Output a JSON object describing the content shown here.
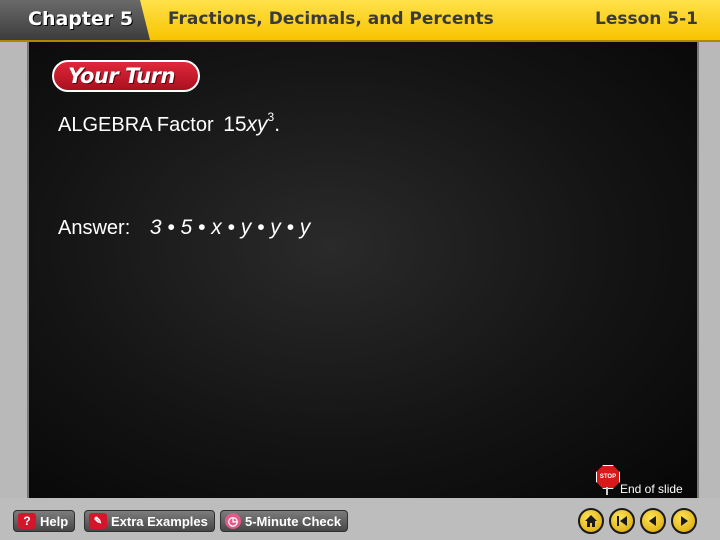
{
  "header": {
    "chapter": "Chapter 5",
    "title": "Fractions, Decimals, and Percents",
    "lesson": "Lesson 5-1"
  },
  "slide": {
    "badge": "Your Turn",
    "question_prefix": "ALGEBRA Factor",
    "question_coef": "15",
    "question_var1": "x",
    "question_var2": "y",
    "question_exp": "3",
    "question_end": ".",
    "answer_label": "Answer:",
    "answer_expression": "3 • 5 • x • y • y • y"
  },
  "end_of_slide": {
    "stop_text": "STOP",
    "label": "End of slide"
  },
  "footer": {
    "help_label": "Help",
    "examples_label": "Extra Examples",
    "check_label": "5-Minute Check"
  },
  "colors": {
    "header_yellow": "#f7c400",
    "badge_red": "#c8182b",
    "panel_black": "#0a0a0a",
    "nav_yellow": "#f2c200"
  },
  "icons": [
    "help-icon",
    "extra-examples-icon",
    "five-minute-check-icon",
    "home-icon",
    "first-slide-icon",
    "previous-icon",
    "next-icon",
    "stop-sign-icon"
  ]
}
